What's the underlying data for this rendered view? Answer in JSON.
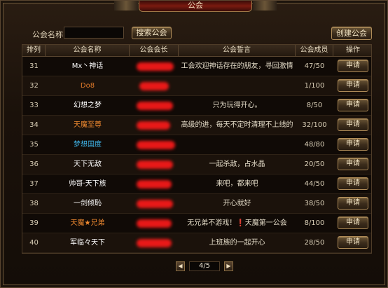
{
  "window": {
    "title": "公会"
  },
  "search": {
    "label": "公会名称",
    "value": "",
    "button": "搜索公会"
  },
  "create_button": "创建公会",
  "table": {
    "headers": [
      "排列",
      "公会名称",
      "公会会长",
      "公会誓言",
      "公会成员",
      "操作"
    ],
    "rows": [
      {
        "rank": "31",
        "name": "Mx丶神话",
        "name_color": "#ffffff",
        "motto": "工会欢迎神话存在的朋友，寻回激情",
        "members": "47/50",
        "action": "申请"
      },
      {
        "rank": "32",
        "name": "Do8",
        "name_color": "#e07a2a",
        "motto": "",
        "members": "1/100",
        "action": "申请"
      },
      {
        "rank": "33",
        "name": "幻想之梦",
        "name_color": "#ffffff",
        "motto": "只为玩得开心。",
        "members": "8/50",
        "action": "申请"
      },
      {
        "rank": "34",
        "name": "天魔至尊",
        "name_color": "#f08a30",
        "motto": "高级的进，每天不定时清理不上线的",
        "members": "32/100",
        "action": "申请"
      },
      {
        "rank": "35",
        "name": "梦想国度",
        "name_color": "#3fb4e8",
        "motto": "",
        "members": "48/80",
        "action": "申请"
      },
      {
        "rank": "36",
        "name": "天下无敌",
        "name_color": "#ffffff",
        "motto": "一起杀敌，占水晶",
        "members": "20/50",
        "action": "申请"
      },
      {
        "rank": "37",
        "name": "帅哥·天下族",
        "name_color": "#ffffff",
        "motto": "来吧，都来吧",
        "members": "44/50",
        "action": "申请"
      },
      {
        "rank": "38",
        "name": "一剑倾恥",
        "name_color": "#ffffff",
        "motto": "开心就好",
        "members": "38/50",
        "action": "申请"
      },
      {
        "rank": "39",
        "name": "天魔★兄弟",
        "name_color": "#f08a30",
        "motto": "无兄弟不游戏！❗天魔第一公会",
        "members": "8/100",
        "action": "申请"
      },
      {
        "rank": "40",
        "name": "军临々天下",
        "name_color": "#ffffff",
        "motto": "上班族的一起开心",
        "members": "28/50",
        "action": "申请"
      }
    ]
  },
  "pager": {
    "text": "4/5",
    "prev": "◀",
    "next": "▶"
  },
  "colors": {
    "accent_border": "#b08c58",
    "title_red": "#7a1a10",
    "redaction": "#ff1a1a"
  }
}
